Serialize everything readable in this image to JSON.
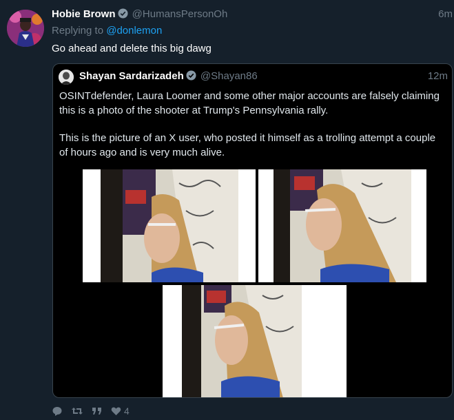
{
  "tweet": {
    "author_name": "Hobie Brown",
    "author_handle": "@HumansPersonOh",
    "time": "6m",
    "replying_prefix": "Replying to",
    "replying_to": "@donlemon",
    "text": "Go ahead and delete this big dawg",
    "avatar_icon": "avatar-illustration"
  },
  "quote": {
    "author_name": "Shayan Sardarizadeh",
    "author_handle": "@Shayan86",
    "time": "12m",
    "paragraph_1": "OSINTdefender, Laura Loomer and some other major accounts are falsely claiming this is a photo of the shooter at Trump's Pennsylvania rally.",
    "paragraph_2": "This is the picture of an X user, who posted it himself as a trolling attempt a couple of hours ago and is very much alive.",
    "photos": [
      "photo-1",
      "photo-2",
      "photo-3"
    ]
  },
  "actions": {
    "reply_icon": "reply-icon",
    "retweet_icon": "retweet-icon",
    "quote_icon": "quote-icon",
    "like_icon": "heart-icon",
    "like_count": "4"
  },
  "colors": {
    "background": "#15202b",
    "accent": "#1da1f2",
    "muted": "#6e7b87",
    "quote_bg": "#000000"
  }
}
